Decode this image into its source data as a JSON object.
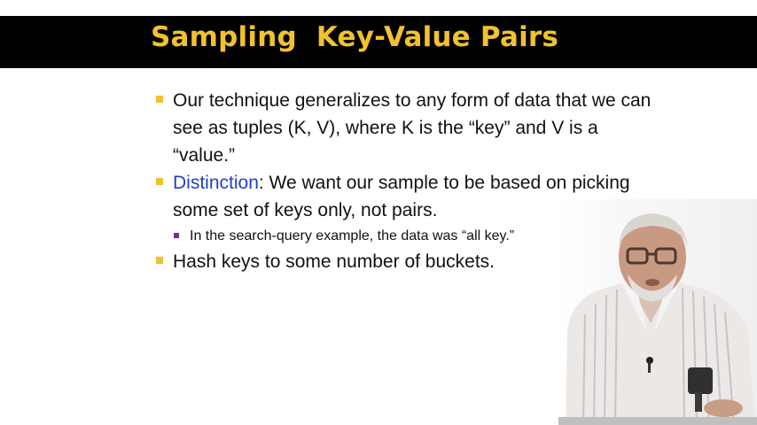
{
  "slide": {
    "title": "Sampling  Key-Value Pairs",
    "bullets": [
      {
        "text": "Our technique generalizes to any form of data that we can see as tuples (K, V), where K is the “key” and V is a “value.”"
      },
      {
        "accent": "Distinction",
        "text": ": We want our sample to be based on picking some set of keys only, not pairs."
      },
      {
        "text": "In the search-query example, the data was “all key.”",
        "level": 2
      },
      {
        "text": "Hash keys to some number of buckets."
      }
    ]
  },
  "colors": {
    "title_bar": "#000000",
    "title_text": "#f2c12e",
    "bullet_marker": "#f2c12e",
    "sub_bullet_marker": "#7a2aa0",
    "accent_text": "#1f3fc9"
  },
  "presenter": {
    "description_icon": "person-icon"
  }
}
